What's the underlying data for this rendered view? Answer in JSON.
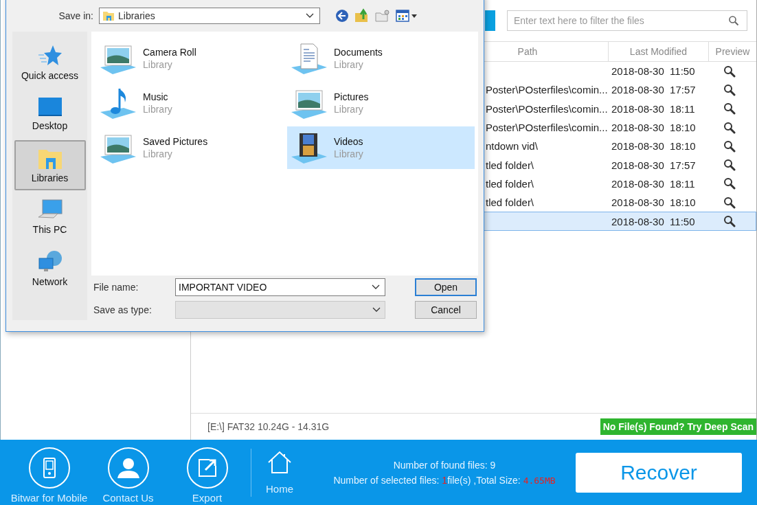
{
  "dialog": {
    "save_in_label": "Save in:",
    "save_in_value": "Libraries",
    "places": [
      {
        "label": "Quick access",
        "kind": "star",
        "selected": false
      },
      {
        "label": "Desktop",
        "kind": "desktop",
        "selected": false
      },
      {
        "label": "Libraries",
        "kind": "folder",
        "selected": true
      },
      {
        "label": "This PC",
        "kind": "computer",
        "selected": false
      },
      {
        "label": "Network",
        "kind": "network",
        "selected": false
      }
    ],
    "items": [
      {
        "name": "Camera Roll",
        "type": "Library",
        "kind": "picture",
        "selected": false
      },
      {
        "name": "Documents",
        "type": "Library",
        "kind": "document",
        "selected": false
      },
      {
        "name": "Music",
        "type": "Library",
        "kind": "music",
        "selected": false
      },
      {
        "name": "Pictures",
        "type": "Library",
        "kind": "picture",
        "selected": false
      },
      {
        "name": "Saved Pictures",
        "type": "Library",
        "kind": "picture",
        "selected": false
      },
      {
        "name": "Videos",
        "type": "Library",
        "kind": "video",
        "selected": true
      }
    ],
    "file_name_label": "File name:",
    "file_name_value": "IMPORTANT VIDEO",
    "save_type_label": "Save as type:",
    "buttons": [
      {
        "label": "Open",
        "default": true
      },
      {
        "label": "Cancel",
        "default": false
      }
    ]
  },
  "search": {
    "placeholder": "Enter text here to filter the files"
  },
  "table": {
    "columns": [
      "Path",
      "Last Modified",
      "Preview"
    ],
    "rows": [
      {
        "modified": "2018-08-30  11:50",
        "selected": false
      },
      {
        "path": "Poster\\POsterfiles\\comin...",
        "modified": "2018-08-30  17:57",
        "selected": false
      },
      {
        "path": "Poster\\POsterfiles\\comin...",
        "modified": "2018-08-30  18:11",
        "selected": false
      },
      {
        "path": "Poster\\POsterfiles\\comin...",
        "modified": "2018-08-30  18:10",
        "selected": false
      },
      {
        "path": "ntdown vid\\",
        "modified": "2018-08-30  18:10",
        "selected": false
      },
      {
        "path": "tled folder\\",
        "modified": "2018-08-30  17:57",
        "selected": false
      },
      {
        "path": "tled folder\\",
        "modified": "2018-08-30  18:11",
        "selected": false
      },
      {
        "path": "tled folder\\",
        "modified": "2018-08-30  18:10",
        "selected": false
      },
      {
        "modified": "2018-08-30  11:50",
        "selected": true
      }
    ]
  },
  "status_bar": {
    "drive": "[E:\\] FAT32 10.24G - 14.31G",
    "deep_scan": "No File(s) Found? Try Deep Scan"
  },
  "bottom_bar": {
    "actions": [
      {
        "label": "Bitwar for Mobile",
        "kind": "mobile"
      },
      {
        "label": "Contact Us",
        "kind": "contact"
      },
      {
        "label": "Export",
        "kind": "export"
      }
    ],
    "home": "Home",
    "found": "Number of found files: 9",
    "selected_label": "Number of selected files:",
    "selected_count": "1",
    "selected_unit": "file(s) ,Total Size:",
    "total_size": "4.65MB",
    "recover": "Recover"
  }
}
